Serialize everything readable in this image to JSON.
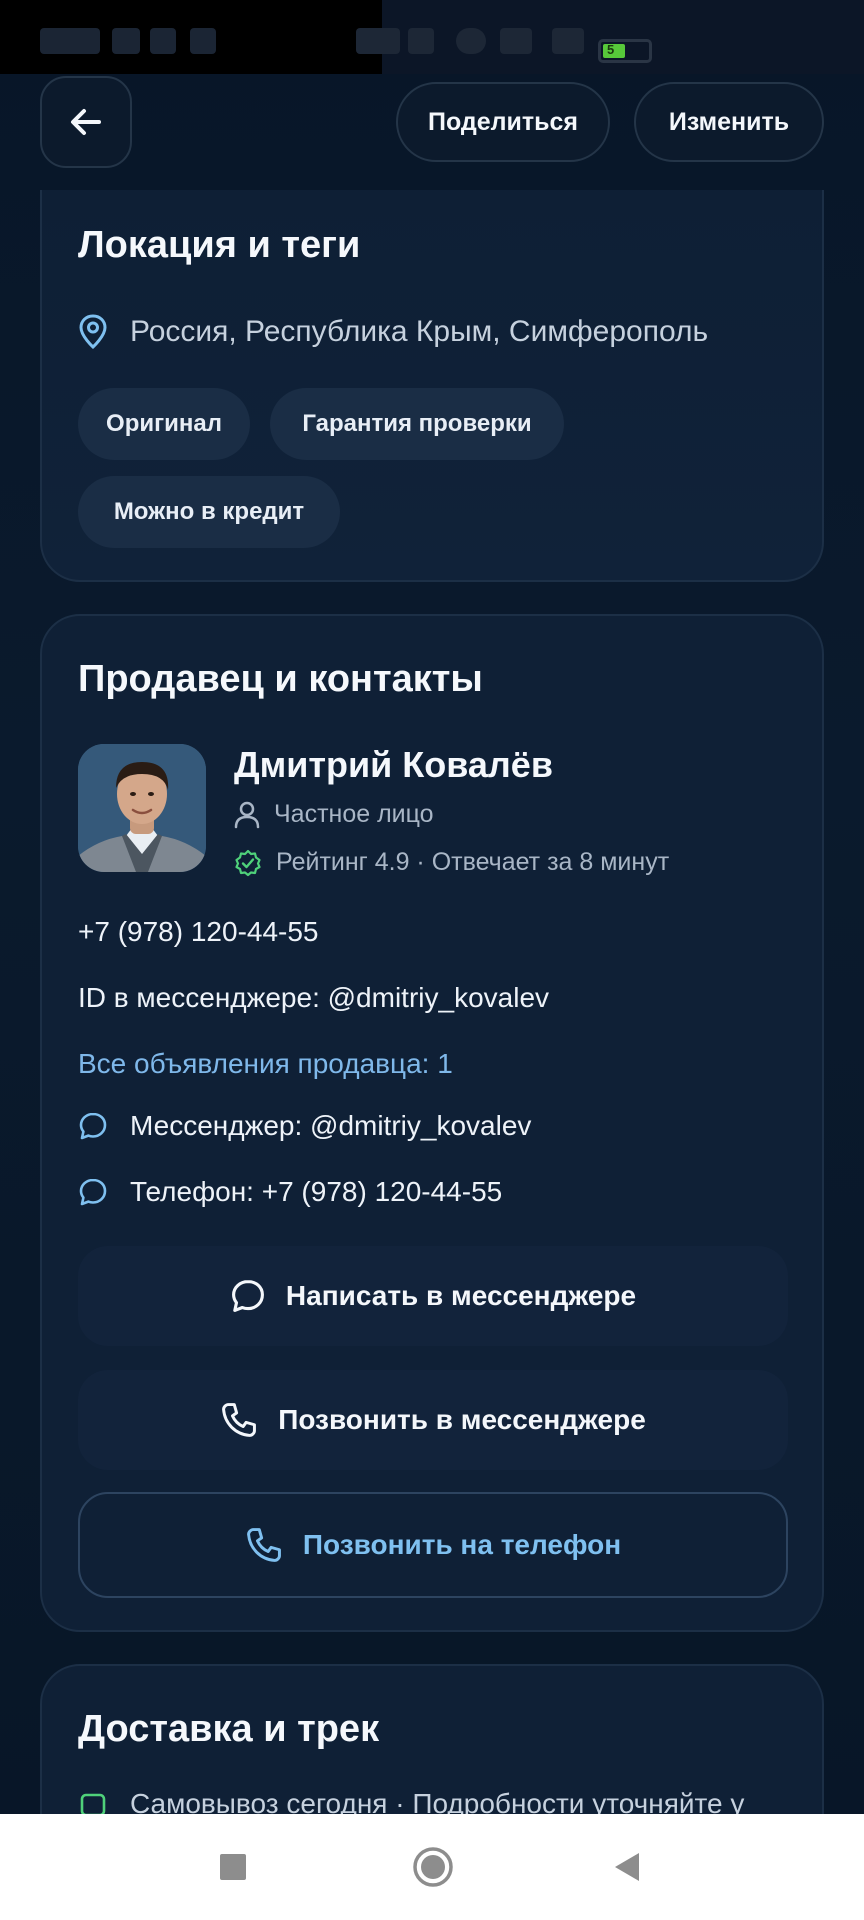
{
  "header": {
    "back_icon": "arrow-left-icon",
    "share_label": "Поделиться",
    "edit_label": "Изменить"
  },
  "status_bar": {
    "battery_level": "5"
  },
  "location_card": {
    "title": "Локация и теги",
    "location_icon": "map-pin-icon",
    "location": "Россия, Республика Крым, Симферополь",
    "tags": [
      "Оригинал",
      "Гарантия проверки",
      "Можно в кредит"
    ]
  },
  "seller_card": {
    "title": "Продавец и контакты",
    "name": "Дмитрий Ковалёв",
    "type_icon": "user-icon",
    "type": "Частное лицо",
    "rating_icon": "verified-check-icon",
    "rating": "Рейтинг 4.9 · Отвечает за 8 минут",
    "phone": "+7 (978) 120-44-55",
    "messenger_id": "ID в мессенджере: @dmitriy_kovalev",
    "all_ads_link": "Все объявления продавца: 1",
    "contacts": [
      {
        "icon": "chat-bubble-icon",
        "text": "Мессенджер: @dmitriy_kovalev"
      },
      {
        "icon": "chat-bubble-icon",
        "text": "Телефон: +7 (978) 120-44-55"
      }
    ],
    "buttons": {
      "write_messenger": "Написать в мессенджере",
      "call_messenger": "Позвонить в мессенджере",
      "call_phone": "Позвонить на телефон"
    },
    "colors": {
      "accent": "#7fc0f0",
      "link": "#7fb8ea",
      "verified": "#4fd17a"
    }
  },
  "delivery_card": {
    "title": "Доставка и трек",
    "line": "Самовывоз сегодня · Подробности уточняйте у"
  },
  "navigation": {
    "recent_icon": "square-icon",
    "home_icon": "circle-home-icon",
    "back_icon": "triangle-back-icon"
  }
}
